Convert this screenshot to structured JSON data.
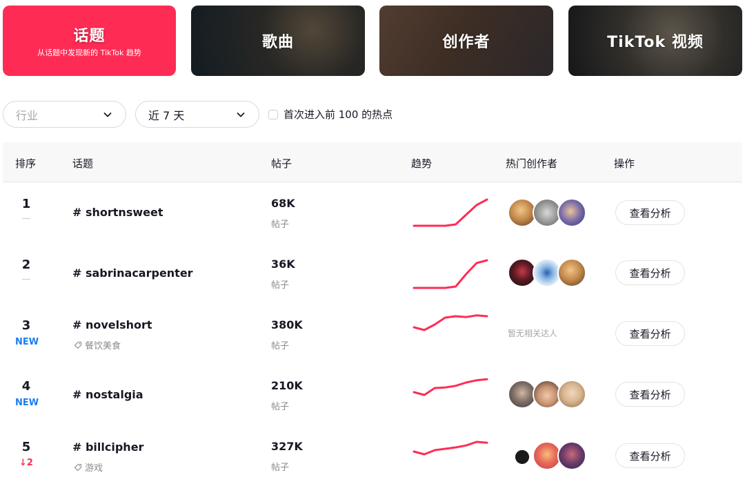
{
  "cards": [
    {
      "title": "话题",
      "subtitle": "从话题中发现新的 TikTok 趋势",
      "active": true
    },
    {
      "title": "歌曲"
    },
    {
      "title": "创作者"
    },
    {
      "title": "TikTok 视频"
    }
  ],
  "filters": {
    "industry_placeholder": "行业",
    "period_value": "近 7 天",
    "checkbox_label": "首次进入前 100 的热点"
  },
  "table": {
    "headers": {
      "rank": "排序",
      "hashtag": "话题",
      "posts": "帖子",
      "trend": "趋势",
      "creators": "热门创作者",
      "action": "操作"
    },
    "rows": [
      {
        "rank": "1",
        "rank_change": "—",
        "change_type": "same",
        "hashtag": "# shortnsweet",
        "industry": "",
        "posts": "68K",
        "posts_label": "帖子",
        "trend": [
          0.05,
          0.05,
          0.05,
          0.05,
          0.1,
          0.45,
          0.8,
          1.0
        ],
        "creator_avatars": [
          "avatar-1a",
          "avatar-1b",
          "avatar-1c"
        ],
        "no_creator_text": "",
        "action": "查看分析"
      },
      {
        "rank": "2",
        "rank_change": "—",
        "change_type": "same",
        "hashtag": "# sabrinacarpenter",
        "industry": "",
        "posts": "36K",
        "posts_label": "帖子",
        "trend": [
          0.0,
          0.0,
          0.0,
          0.0,
          0.05,
          0.5,
          0.9,
          1.0
        ],
        "creator_avatars": [
          "avatar-2a",
          "avatar-2b",
          "avatar-2c"
        ],
        "no_creator_text": "",
        "action": "查看分析"
      },
      {
        "rank": "3",
        "rank_change": "NEW",
        "change_type": "new",
        "hashtag": "# novelshort",
        "industry": "餐饮美食",
        "posts": "380K",
        "posts_label": "帖子",
        "trend": [
          0.55,
          0.45,
          0.65,
          0.9,
          0.95,
          0.92,
          0.98,
          0.95
        ],
        "creator_avatars": [],
        "no_creator_text": "暂无相关达人",
        "action": "查看分析"
      },
      {
        "rank": "4",
        "rank_change": "NEW",
        "change_type": "new",
        "hashtag": "# nostalgia",
        "industry": "",
        "posts": "210K",
        "posts_label": "帖子",
        "trend": [
          0.45,
          0.35,
          0.6,
          0.62,
          0.68,
          0.8,
          0.88,
          0.92
        ],
        "creator_avatars": [
          "avatar-4a",
          "avatar-4b",
          "avatar-4c"
        ],
        "no_creator_text": "",
        "action": "查看分析"
      },
      {
        "rank": "5",
        "rank_change": "↓2",
        "change_type": "down",
        "hashtag": "# billcipher",
        "industry": "游戏",
        "posts": "327K",
        "posts_label": "帖子",
        "trend": [
          0.5,
          0.4,
          0.55,
          0.6,
          0.65,
          0.72,
          0.85,
          0.82
        ],
        "creator_avatars": [
          "avatar-5a",
          "avatar-5b",
          "avatar-5c"
        ],
        "no_creator_text": "",
        "action": "查看分析"
      }
    ]
  },
  "colors": {
    "brand": "#fe2c55",
    "trend_line": "#fe2c55",
    "new_badge": "#1b7ef2",
    "down_badge": "#fe2c55"
  }
}
